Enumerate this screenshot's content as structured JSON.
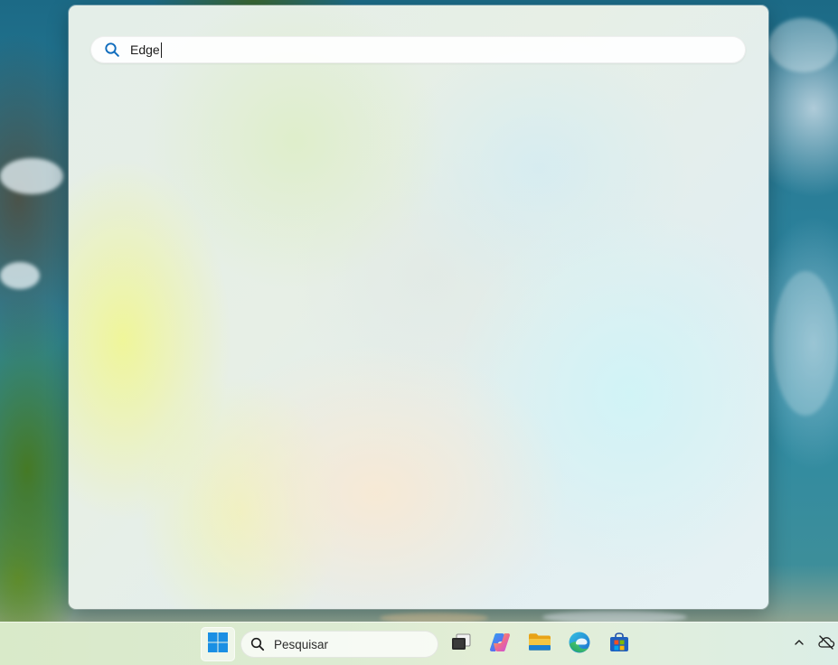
{
  "start_menu": {
    "search": {
      "query": "Edge",
      "icon": "search-icon"
    }
  },
  "taskbar": {
    "start_icon": "windows-logo-icon",
    "search": {
      "placeholder": "Pesquisar",
      "icon": "search-icon"
    },
    "pinned_apps": [
      {
        "name": "task-view",
        "icon": "task-view-icon"
      },
      {
        "name": "copilot",
        "icon": "copilot-icon"
      },
      {
        "name": "file-explorer",
        "icon": "folder-icon"
      },
      {
        "name": "microsoft-edge",
        "icon": "edge-icon"
      },
      {
        "name": "microsoft-store",
        "icon": "store-icon"
      }
    ],
    "tray": {
      "overflow_icon": "chevron-up-icon",
      "network_icon": "cloud-offline-icon"
    }
  },
  "colors": {
    "windows_blue": "#1a8fe3",
    "search_icon_blue": "#0f6cbd",
    "folder_yellow": "#f4b63f",
    "edge_teal": "#1bb4a4"
  }
}
